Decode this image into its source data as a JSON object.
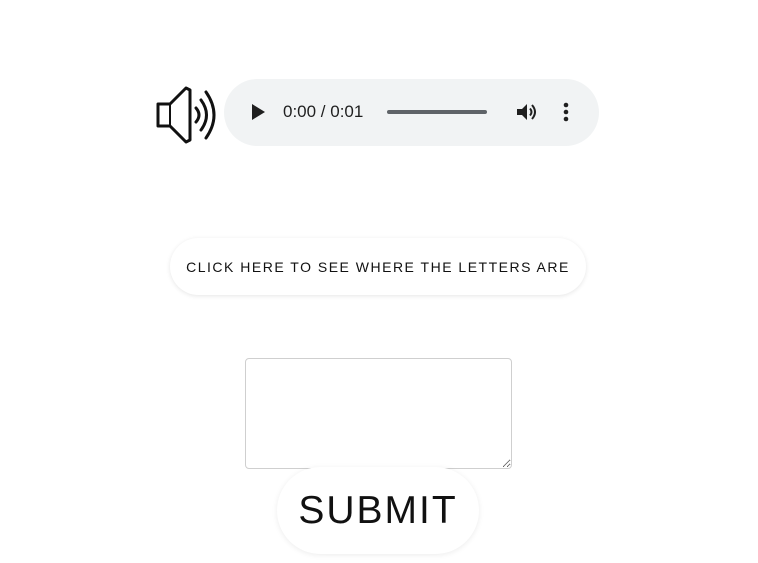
{
  "audio": {
    "speaker_icon": "speaker-icon",
    "time_display": "0:00 / 0:01",
    "play_icon": "play-icon",
    "volume_icon": "volume-icon",
    "menu_icon": "more-vert-icon",
    "progress": 0,
    "background_color": "#f1f3f4"
  },
  "hint_button": {
    "label": "CLICK HERE TO SEE WHERE THE LETTERS ARE"
  },
  "answer_input": {
    "value": "",
    "placeholder": ""
  },
  "submit_button": {
    "label": "SUBMIT"
  }
}
